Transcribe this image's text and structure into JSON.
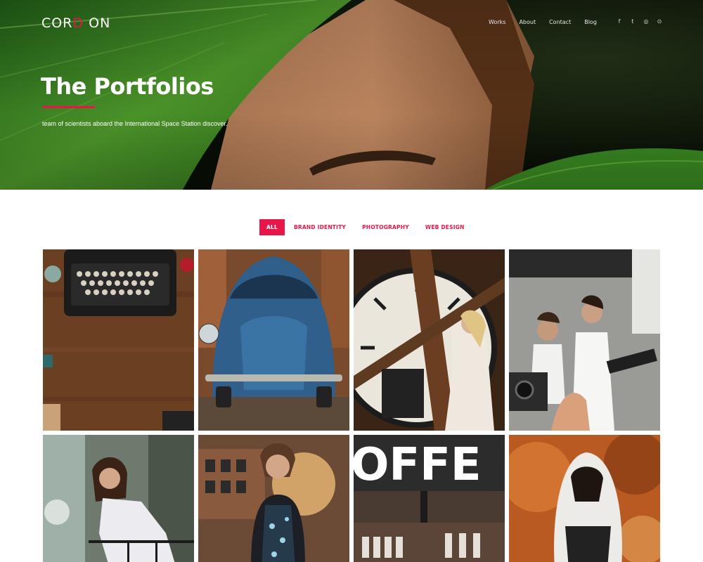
{
  "brand": {
    "logo_left": "COR",
    "logo_accent": "D",
    "logo_right": " ON"
  },
  "nav": {
    "items": [
      "Works",
      "About",
      "Contact",
      "Blog"
    ]
  },
  "social": [
    {
      "icon": "facebook-icon",
      "glyph": "f"
    },
    {
      "icon": "twitter-icon",
      "glyph": "t"
    },
    {
      "icon": "instagram-icon",
      "glyph": "◎"
    },
    {
      "icon": "pinterest-icon",
      "glyph": "⊙"
    }
  ],
  "hero": {
    "title": "The Portfolios",
    "subtitle": "team of scientists aboard the International Space Station discover."
  },
  "filters": {
    "items": [
      "ALL",
      "BRAND IDENTITY",
      "PHOTOGRAPHY",
      "WEB DESIGN"
    ],
    "active": "ALL"
  },
  "portfolio": {
    "items": [
      {
        "name": "typewriter-photo"
      },
      {
        "name": "blue-car-photo"
      },
      {
        "name": "clock-tower-photo"
      },
      {
        "name": "photoshoot-photo"
      },
      {
        "name": "balcony-woman-photo"
      },
      {
        "name": "sunset-portrait-photo"
      },
      {
        "name": "coffee-sign-photo",
        "sign_text": "OFFE"
      },
      {
        "name": "hoodie-smoke-photo"
      }
    ]
  },
  "colors": {
    "accent": "#e8174a",
    "text_light": "#ffffff"
  }
}
